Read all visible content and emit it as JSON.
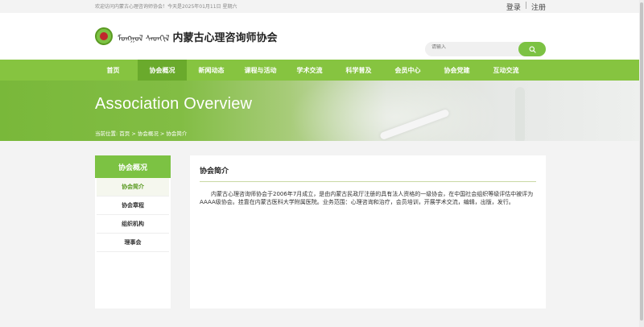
{
  "topbar": {
    "welcome": "欢迎访问内蒙古心理咨询师协会！今天是2025年01月11日 星期六",
    "login": "登录",
    "separator": "|",
    "register": "注册"
  },
  "header": {
    "mongolian_text": "ᠮᠣᠩᠭᠣᠯ ᠰᠡᠳᠬᠢᠯ",
    "site_title": "内蒙古心理咨询师协会",
    "search_placeholder": "请输入",
    "search_icon": "search-icon"
  },
  "nav": {
    "items": [
      {
        "label": "首页"
      },
      {
        "label": "协会概况"
      },
      {
        "label": "新闻动态"
      },
      {
        "label": "课程与活动"
      },
      {
        "label": "学术交流"
      },
      {
        "label": "科学普及"
      },
      {
        "label": "会员中心"
      },
      {
        "label": "协会党建"
      },
      {
        "label": "互动交流"
      }
    ],
    "active_index": 1
  },
  "banner": {
    "title": "Association Overview",
    "breadcrumb": "当前位置: 首页 > 协会概况 > 协会简介"
  },
  "sidebar": {
    "title": "协会概况",
    "items": [
      {
        "label": "协会简介"
      },
      {
        "label": "协会章程"
      },
      {
        "label": "组织机构"
      },
      {
        "label": "理事会"
      }
    ],
    "active_index": 0
  },
  "content": {
    "title": "协会简介",
    "body": "内蒙古心理咨询师协会于2006年7月成立，是由内蒙古民政厅注册的具有法人资格的一级协会，在中国社会组织等级评估中被评为AAAA级协会。挂靠在内蒙古医科大学附属医院。业务范围：心理咨询和治疗，会员培训，开展学术交流，编辑，出版，发行。"
  },
  "colors": {
    "brand_green": "#86c440",
    "nav_active": "#6aaa2c",
    "emblem_red": "#c0272d"
  }
}
